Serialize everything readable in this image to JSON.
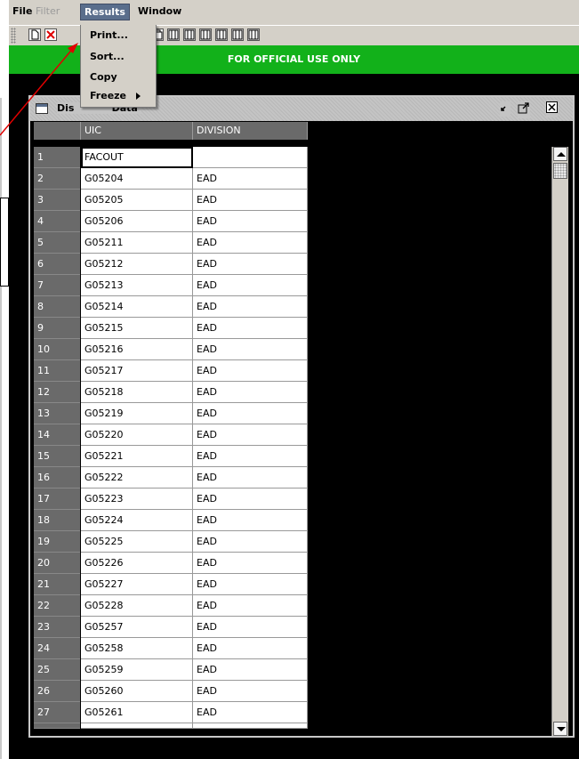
{
  "menubar": {
    "items": [
      {
        "label": "File",
        "state": "normal"
      },
      {
        "label": "Filter",
        "state": "disabled"
      },
      {
        "label": "Results",
        "state": "active"
      },
      {
        "label": "Window",
        "state": "normal"
      }
    ]
  },
  "results_menu": {
    "items": [
      "Print...",
      "Sort...",
      "Copy",
      "Freeze"
    ]
  },
  "toolbar": {
    "icons": [
      "new-document-icon",
      "delete-icon",
      "copy-icon",
      "column-icon"
    ]
  },
  "banner": {
    "text": "FOR OFFICIAL USE ONLY",
    "color": "#12b11a"
  },
  "frame": {
    "title": "Display : Unit Data",
    "title_visible": "Dis           Data"
  },
  "table": {
    "columns": [
      "UIC",
      "DIVISION"
    ],
    "rows": [
      {
        "n": "1",
        "uic": "FACOUT",
        "division": ""
      },
      {
        "n": "2",
        "uic": "G05204",
        "division": "EAD"
      },
      {
        "n": "3",
        "uic": "G05205",
        "division": "EAD"
      },
      {
        "n": "4",
        "uic": "G05206",
        "division": "EAD"
      },
      {
        "n": "5",
        "uic": "G05211",
        "division": "EAD"
      },
      {
        "n": "6",
        "uic": "G05212",
        "division": "EAD"
      },
      {
        "n": "7",
        "uic": "G05213",
        "division": "EAD"
      },
      {
        "n": "8",
        "uic": "G05214",
        "division": "EAD"
      },
      {
        "n": "9",
        "uic": "G05215",
        "division": "EAD"
      },
      {
        "n": "10",
        "uic": "G05216",
        "division": "EAD"
      },
      {
        "n": "11",
        "uic": "G05217",
        "division": "EAD"
      },
      {
        "n": "12",
        "uic": "G05218",
        "division": "EAD"
      },
      {
        "n": "13",
        "uic": "G05219",
        "division": "EAD"
      },
      {
        "n": "14",
        "uic": "G05220",
        "division": "EAD"
      },
      {
        "n": "15",
        "uic": "G05221",
        "division": "EAD"
      },
      {
        "n": "16",
        "uic": "G05222",
        "division": "EAD"
      },
      {
        "n": "17",
        "uic": "G05223",
        "division": "EAD"
      },
      {
        "n": "18",
        "uic": "G05224",
        "division": "EAD"
      },
      {
        "n": "19",
        "uic": "G05225",
        "division": "EAD"
      },
      {
        "n": "20",
        "uic": "G05226",
        "division": "EAD"
      },
      {
        "n": "21",
        "uic": "G05227",
        "division": "EAD"
      },
      {
        "n": "22",
        "uic": "G05228",
        "division": "EAD"
      },
      {
        "n": "23",
        "uic": "G05257",
        "division": "EAD"
      },
      {
        "n": "24",
        "uic": "G05258",
        "division": "EAD"
      },
      {
        "n": "25",
        "uic": "G05259",
        "division": "EAD"
      },
      {
        "n": "26",
        "uic": "G05260",
        "division": "EAD"
      },
      {
        "n": "27",
        "uic": "G05261",
        "division": "EAD"
      }
    ]
  }
}
